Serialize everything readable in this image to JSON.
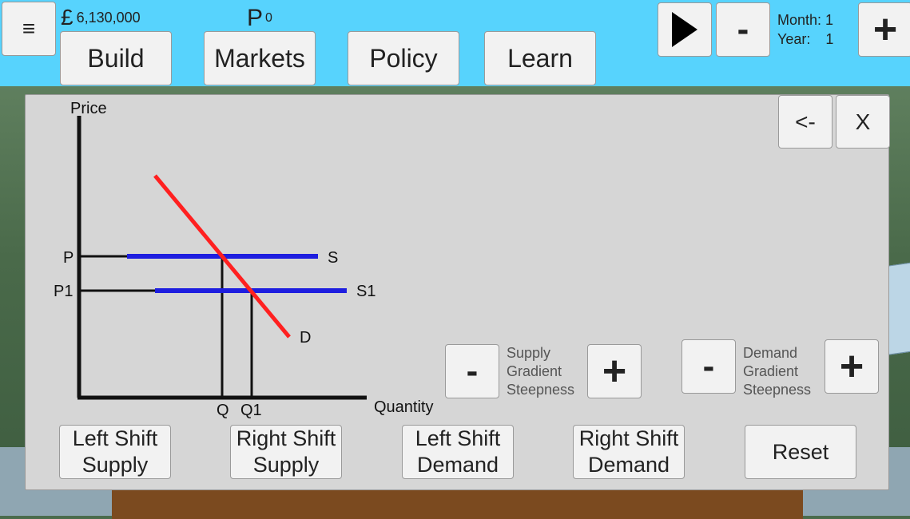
{
  "topbar": {
    "menu_icon": "hamburger-icon",
    "menu_glyph": "≡",
    "currency_symbol": "£",
    "money": "6,130,000",
    "points_symbol": "P",
    "points": "0",
    "nav": [
      "Build",
      "Markets",
      "Policy",
      "Learn"
    ],
    "play_icon": "play-icon",
    "minus_label": "-",
    "plus_label": "+",
    "month_label": "Month:",
    "month_value": "1",
    "year_label": "Year:",
    "year_value": "1"
  },
  "panel": {
    "back_label": "<-",
    "close_label": "X",
    "supply_minus": "-",
    "supply_plus": "+",
    "supply_label": [
      "Supply",
      "Gradient",
      "Steepness"
    ],
    "demand_minus": "-",
    "demand_plus": "+",
    "demand_label": [
      "Demand",
      "Gradient",
      "Steepness"
    ],
    "left_shift_supply": [
      "Left Shift",
      "Supply"
    ],
    "right_shift_supply": [
      "Right Shift",
      "Supply"
    ],
    "left_shift_demand": [
      "Left Shift",
      "Demand"
    ],
    "right_shift_demand": [
      "Right Shift",
      "Demand"
    ],
    "reset": "Reset"
  },
  "graph": {
    "y_axis_label": "Price",
    "x_axis_label": "Quantity",
    "supply_label": "S",
    "supply1_label": "S1",
    "demand_label": "D",
    "price_label": "P",
    "price1_label": "P1",
    "q_label": "Q",
    "q1_label": "Q1",
    "colors": {
      "demand": "#ff2020",
      "supply": "#1e1edf",
      "axes": "#111111"
    }
  }
}
